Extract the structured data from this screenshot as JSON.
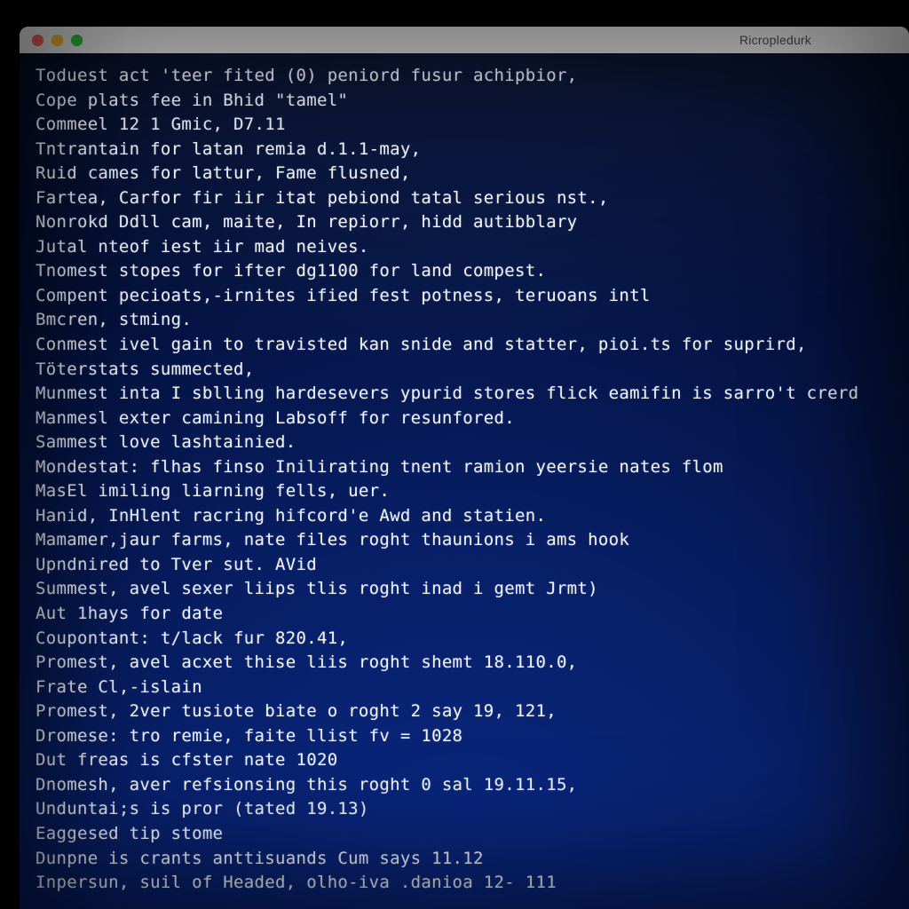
{
  "window": {
    "title": "Ricropledurk"
  },
  "terminal": {
    "lines": [
      "Toduest act 'teer fited (0) peniord fusur achipbior,",
      "Cope plats fee in Bhid \"tamel\"",
      "Commeel 12 1 Gmic, D7.11",
      "Tntrantain for latan remia d.1.1-may,",
      "Ruid cames for lattur, Fame flusned,",
      "Fartea, Carfor fir iir itat pebiond tatal serious nst.,",
      "Nonrokd Ddll cam, maite, In repiorr, hidd autibblary",
      "Jutal nteof iest iir mad neives.",
      "Tnomest stopes for ifter dg1100 for land compest.",
      "Compent pecioats,-irnites ified fest potness, teruoans intl",
      "Bmcren, stming.",
      "Conmest ivel gain to travisted kan snide and statter, pioi.ts for suprird,",
      "Töterstats summected,",
      "Munmest inta I sblling hardesevers ypurid stores flick eamifin is sarro't crerd",
      "Manmesl exter camining Labsoff for resunfored.",
      "Sammest love lashtainied.",
      "Mondestat: flhas finso Inilirating tnent ramion yeersie nates flom",
      "MasEl imiling liarning fells, uer.",
      "Hanid, InHlent racring hifcord'e Awd and statien.",
      "Mamamer,jaur farms, nate files roght thaunions i ams hook",
      "Upndnired to Tver sut. AVid",
      "Summest, avel sexer liips tlis roght inad i gemt Jrmt)",
      "Aut 1hays for date",
      "Coupontant: t/lack fur 820.41,",
      "Promest, avel acxet thise liis roght shemt 18.110.0,",
      "",
      "Frate Cl,-islain",
      "Promest, 2ver tusiote biate o roght 2 say 19, 121,",
      "Dromese: tro remie, faite llist fv = 1028",
      "Dut freas is cfster nate 1020",
      "Dnomesh, aver refsionsing this roght 0 sal 19.11.15,",
      "Unduntai;s is pror (tated 19.13)",
      "",
      "Eaggesed tip stome",
      "Dunpne is crants anttisuands Cum says 11.12",
      "Inpersun, suil of Headed, olho-iva .danioa 12- 111"
    ]
  }
}
